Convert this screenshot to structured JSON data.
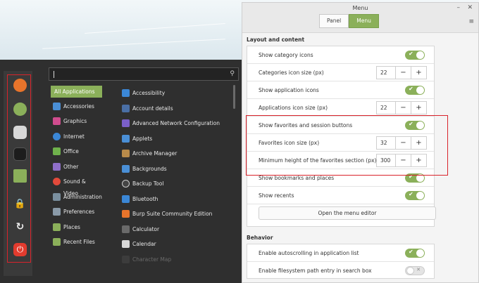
{
  "window": {
    "title": "Menu",
    "tabs": [
      "Panel",
      "Menu"
    ],
    "active_tab": "Menu",
    "minimize_glyph": "–",
    "close_glyph": "✕",
    "menu_glyph": "≡"
  },
  "layout_section": {
    "title": "Layout and content",
    "show_category_icons": {
      "label": "Show category icons",
      "state": "on"
    },
    "categories_icon_size": {
      "label": "Categories icon size (px)",
      "value": "22"
    },
    "show_application_icons": {
      "label": "Show application icons",
      "state": "on"
    },
    "applications_icon_size": {
      "label": "Applications icon size (px)",
      "value": "22"
    },
    "show_favorites": {
      "label": "Show favorites and session buttons",
      "state": "on"
    },
    "favorites_icon_size": {
      "label": "Favorites icon size (px)",
      "value": "32"
    },
    "min_height_favorites": {
      "label": "Minimum height of the favorites section (px)",
      "value": "300"
    },
    "show_bookmarks": {
      "label": "Show bookmarks and places",
      "state": "on"
    },
    "show_recents": {
      "label": "Show recents",
      "state": "on"
    },
    "editor_button": "Open the menu editor"
  },
  "behavior_section": {
    "title": "Behavior",
    "autoscroll": {
      "label": "Enable autoscrolling in application list",
      "state": "on"
    },
    "filesystem_path": {
      "label": "Enable filesystem path entry in search box",
      "state": "off"
    }
  },
  "spin_glyphs": {
    "minus": "−",
    "plus": "+"
  },
  "toggle_glyphs": {
    "on": "✔",
    "off": "✕"
  },
  "menu": {
    "search": {
      "value": "",
      "icon": "search-icon",
      "glyph": "⚲"
    },
    "favorites": [
      {
        "name": "firefox-icon",
        "color": "#e8742b"
      },
      {
        "name": "mint-logo-icon",
        "color": "#8bb05a"
      },
      {
        "name": "settings-toggles-icon",
        "color": "#cfcfcf"
      },
      {
        "name": "terminal-icon",
        "color": "#1d1d1d"
      },
      {
        "name": "folder-icon",
        "color": "#8bb05a"
      },
      {
        "name": "lock-icon",
        "color": "#2f2f2f"
      },
      {
        "name": "logout-icon",
        "color": "#2f2f2f"
      },
      {
        "name": "power-icon",
        "color": "#e23b2e"
      }
    ],
    "session_glyphs": {
      "lock": "🔒",
      "logout": "↻",
      "power": "⏻"
    },
    "categories": [
      {
        "label": "All Applications",
        "icon": "",
        "color": "",
        "active": true
      },
      {
        "label": "Accessories",
        "icon": "accessories-icon",
        "color": "#4a8fd6",
        "active": false
      },
      {
        "label": "Graphics",
        "icon": "graphics-icon",
        "color": "#d04c8e",
        "active": false
      },
      {
        "label": "Internet",
        "icon": "internet-icon",
        "color": "#3b87d6",
        "active": false
      },
      {
        "label": "Office",
        "icon": "office-icon",
        "color": "#6fb14c",
        "active": false
      },
      {
        "label": "Other",
        "icon": "other-icon",
        "color": "#8f6fc9",
        "active": false
      },
      {
        "label": "Sound & Video",
        "icon": "sound-video-icon",
        "color": "#e24a3b",
        "active": false
      },
      {
        "label": "Administration",
        "icon": "administration-icon",
        "color": "#7a8f9f",
        "active": false
      },
      {
        "label": "Preferences",
        "icon": "preferences-icon",
        "color": "#8a9aa8",
        "active": false
      },
      {
        "label": "Places",
        "icon": "places-icon",
        "color": "#8bb05a",
        "active": false
      },
      {
        "label": "Recent Files",
        "icon": "recent-files-icon",
        "color": "#8bb05a",
        "active": false
      }
    ],
    "apps": [
      {
        "label": "Accessibility",
        "icon": "accessibility-icon",
        "color": "#3b87d6"
      },
      {
        "label": "Account details",
        "icon": "account-details-icon",
        "color": "#4a6fa5"
      },
      {
        "label": "Advanced Network Configuration",
        "icon": "network-config-icon",
        "color": "#7a5fc9"
      },
      {
        "label": "Applets",
        "icon": "applets-icon",
        "color": "#4a8fd6"
      },
      {
        "label": "Archive Manager",
        "icon": "archive-manager-icon",
        "color": "#b88a4a"
      },
      {
        "label": "Backgrounds",
        "icon": "backgrounds-icon",
        "color": "#4a8fd6"
      },
      {
        "label": "Backup Tool",
        "icon": "backup-tool-icon",
        "color": "#444444"
      },
      {
        "label": "Bluetooth",
        "icon": "bluetooth-icon",
        "color": "#3b87d6"
      },
      {
        "label": "Burp Suite Community Edition",
        "icon": "burp-suite-icon",
        "color": "#e8742b"
      },
      {
        "label": "Calculator",
        "icon": "calculator-icon",
        "color": "#6a6a6a"
      },
      {
        "label": "Calendar",
        "icon": "calendar-icon",
        "color": "#d8d8d8"
      },
      {
        "label": "Character Map",
        "icon": "character-map-icon",
        "color": "#5a5a5a"
      }
    ]
  }
}
